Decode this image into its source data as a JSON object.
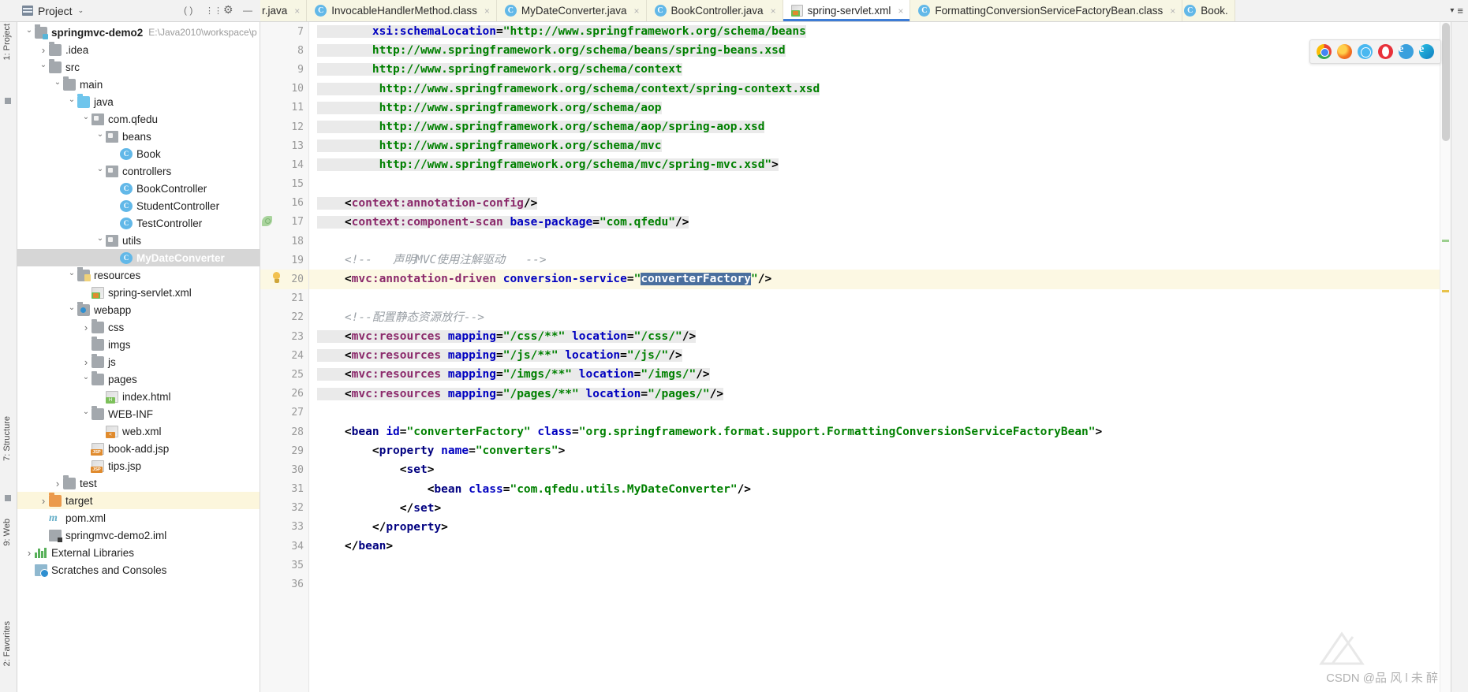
{
  "toolwindow": {
    "title": "Project",
    "dropdown_caret": "⌄",
    "buttons": [
      {
        "name": "collapse-all",
        "glyph": "( )"
      },
      {
        "name": "settings",
        "glyph": "⚙"
      },
      {
        "name": "hide",
        "glyph": "—"
      }
    ]
  },
  "tabs": [
    {
      "label": "r.java",
      "icon": "java-file-icon",
      "active": false,
      "truncated": true,
      "close": "×"
    },
    {
      "label": "InvocableHandlerMethod.class",
      "icon": "class-icon",
      "active": false,
      "close": "×"
    },
    {
      "label": "MyDateConverter.java",
      "icon": "class-icon",
      "active": false,
      "close": "×"
    },
    {
      "label": "BookController.java",
      "icon": "class-icon",
      "active": false,
      "close": "×"
    },
    {
      "label": "spring-servlet.xml",
      "icon": "xml-file-icon",
      "active": true,
      "close": "×"
    },
    {
      "label": "FormattingConversionServiceFactoryBean.class",
      "icon": "class-icon",
      "active": false,
      "close": "×"
    },
    {
      "label": "Book.",
      "icon": "class-icon",
      "active": false,
      "truncated": true,
      "close": ""
    }
  ],
  "tabs_end": {
    "dropdown": "▾",
    "list": "≡"
  },
  "left_strips": {
    "top_label": "1: Project",
    "bottom_labels": [
      "7: Structure",
      "9: Web",
      "2: Favorites"
    ]
  },
  "tree": [
    {
      "indent": 0,
      "arrow": "down",
      "icon": "module-icon",
      "label": "springmvc-demo2",
      "bold": true,
      "dim": "E:\\Java2010\\workspace\\p",
      "state": "normal"
    },
    {
      "indent": 1,
      "arrow": "right",
      "icon": "folder-grey",
      "label": ".idea",
      "state": "normal"
    },
    {
      "indent": 1,
      "arrow": "down",
      "icon": "folder-grey",
      "label": "src",
      "state": "normal"
    },
    {
      "indent": 2,
      "arrow": "down",
      "icon": "folder-grey",
      "label": "main",
      "state": "normal"
    },
    {
      "indent": 3,
      "arrow": "down",
      "icon": "folder-blue",
      "label": "java",
      "state": "normal"
    },
    {
      "indent": 4,
      "arrow": "down",
      "icon": "package-icon",
      "label": "com.qfedu",
      "state": "normal"
    },
    {
      "indent": 5,
      "arrow": "down",
      "icon": "package-icon",
      "label": "beans",
      "state": "normal"
    },
    {
      "indent": 6,
      "arrow": "none",
      "icon": "class-icon",
      "label": "Book",
      "state": "normal"
    },
    {
      "indent": 5,
      "arrow": "down",
      "icon": "package-icon",
      "label": "controllers",
      "state": "normal"
    },
    {
      "indent": 6,
      "arrow": "none",
      "icon": "class-icon",
      "label": "BookController",
      "state": "normal"
    },
    {
      "indent": 6,
      "arrow": "none",
      "icon": "class-icon",
      "label": "StudentController",
      "state": "normal"
    },
    {
      "indent": 6,
      "arrow": "none",
      "icon": "class-icon",
      "label": "TestController",
      "state": "normal"
    },
    {
      "indent": 5,
      "arrow": "down",
      "icon": "package-icon",
      "label": "utils",
      "state": "normal"
    },
    {
      "indent": 6,
      "arrow": "none",
      "icon": "class-icon",
      "label": "MyDateConverter",
      "state": "selected"
    },
    {
      "indent": 3,
      "arrow": "down",
      "icon": "folder-resources",
      "label": "resources",
      "state": "normal"
    },
    {
      "indent": 4,
      "arrow": "none",
      "icon": "xml-file-icon",
      "label": "spring-servlet.xml",
      "state": "normal"
    },
    {
      "indent": 3,
      "arrow": "down",
      "icon": "folder-web",
      "label": "webapp",
      "state": "normal"
    },
    {
      "indent": 4,
      "arrow": "right",
      "icon": "folder-grey",
      "label": "css",
      "state": "normal"
    },
    {
      "indent": 4,
      "arrow": "none",
      "icon": "folder-grey",
      "label": "imgs",
      "state": "normal"
    },
    {
      "indent": 4,
      "arrow": "right",
      "icon": "folder-grey",
      "label": "js",
      "state": "normal"
    },
    {
      "indent": 4,
      "arrow": "down",
      "icon": "folder-grey",
      "label": "pages",
      "state": "normal"
    },
    {
      "indent": 5,
      "arrow": "none",
      "icon": "html-file-icon",
      "label": "index.html",
      "state": "normal"
    },
    {
      "indent": 4,
      "arrow": "down",
      "icon": "folder-grey",
      "label": "WEB-INF",
      "state": "normal"
    },
    {
      "indent": 5,
      "arrow": "none",
      "icon": "webxml-file-icon",
      "label": "web.xml",
      "state": "normal"
    },
    {
      "indent": 4,
      "arrow": "none",
      "icon": "jsp-file-icon",
      "label": "book-add.jsp",
      "state": "normal"
    },
    {
      "indent": 4,
      "arrow": "none",
      "icon": "jsp-file-icon",
      "label": "tips.jsp",
      "state": "normal"
    },
    {
      "indent": 2,
      "arrow": "right",
      "icon": "folder-grey",
      "label": "test",
      "state": "normal"
    },
    {
      "indent": 1,
      "arrow": "right",
      "icon": "folder-orange",
      "label": "target",
      "state": "highlight"
    },
    {
      "indent": 1,
      "arrow": "none",
      "icon": "maven-icon",
      "label": "pom.xml",
      "state": "normal"
    },
    {
      "indent": 1,
      "arrow": "none",
      "icon": "iml-file-icon",
      "label": "springmvc-demo2.iml",
      "state": "normal"
    },
    {
      "indent": 0,
      "arrow": "right",
      "icon": "libraries-icon",
      "label": "External Libraries",
      "state": "normal"
    },
    {
      "indent": 0,
      "arrow": "none",
      "icon": "scratches-icon",
      "label": "Scratches and Consoles",
      "state": "normal"
    }
  ],
  "editor": {
    "first_line_number": 7,
    "current_line": 20,
    "selection_text": "converterFactory",
    "gutter_icons": [
      {
        "line": 17,
        "icon": "inspection-leaf-icon"
      },
      {
        "line": 20,
        "icon": "intention-bulb-icon"
      }
    ],
    "lines": [
      {
        "n": 7,
        "segs": [
          {
            "t": "        ",
            "c": "plain"
          },
          {
            "t": "xsi:schemaLocation",
            "c": "attr"
          },
          {
            "t": "=",
            "c": "punct"
          },
          {
            "t": "\"http://www.springframework.org/schema/beans",
            "c": "str"
          }
        ],
        "hl": true
      },
      {
        "n": 8,
        "segs": [
          {
            "t": "        http://www.springframework.org/schema/beans/spring-beans.xsd",
            "c": "str"
          }
        ],
        "hl": true
      },
      {
        "n": 9,
        "segs": [
          {
            "t": "        http://www.springframework.org/schema/context",
            "c": "str"
          }
        ],
        "hl": true
      },
      {
        "n": 10,
        "segs": [
          {
            "t": "         http://www.springframework.org/schema/context/spring-context.xsd",
            "c": "str"
          }
        ],
        "hl": true
      },
      {
        "n": 11,
        "segs": [
          {
            "t": "         http://www.springframework.org/schema/aop",
            "c": "str"
          }
        ],
        "hl": true
      },
      {
        "n": 12,
        "segs": [
          {
            "t": "         http://www.springframework.org/schema/aop/spring-aop.xsd",
            "c": "str"
          }
        ],
        "hl": true
      },
      {
        "n": 13,
        "segs": [
          {
            "t": "         http://www.springframework.org/schema/mvc",
            "c": "str"
          }
        ],
        "hl": true
      },
      {
        "n": 14,
        "segs": [
          {
            "t": "         http://www.springframework.org/schema/mvc/spring-mvc.xsd\"",
            "c": "str"
          },
          {
            "t": ">",
            "c": "punct"
          }
        ],
        "hl": true
      },
      {
        "n": 15,
        "segs": [],
        "hl": false
      },
      {
        "n": 16,
        "segs": [
          {
            "t": "    ",
            "c": "plain"
          },
          {
            "t": "<",
            "c": "punct"
          },
          {
            "t": "context:annotation-config",
            "c": "tagns"
          },
          {
            "t": "/>",
            "c": "punct"
          }
        ],
        "hl": true
      },
      {
        "n": 17,
        "segs": [
          {
            "t": "    ",
            "c": "plain"
          },
          {
            "t": "<",
            "c": "punct"
          },
          {
            "t": "context:component-scan",
            "c": "tagns"
          },
          {
            "t": " ",
            "c": "plain"
          },
          {
            "t": "base-package",
            "c": "attr"
          },
          {
            "t": "=",
            "c": "punct"
          },
          {
            "t": "\"com.qfedu\"",
            "c": "str"
          },
          {
            "t": "/>",
            "c": "punct"
          }
        ],
        "hl": true
      },
      {
        "n": 18,
        "segs": [],
        "hl": false
      },
      {
        "n": 19,
        "segs": [
          {
            "t": "    ",
            "c": "plain"
          },
          {
            "t": "<!--   声明MVC使用注解驱动   -->",
            "c": "cmt"
          }
        ],
        "hl": false
      },
      {
        "n": 20,
        "segs": [
          {
            "t": "    ",
            "c": "plain"
          },
          {
            "t": "<",
            "c": "punct"
          },
          {
            "t": "mvc:annotation-driven",
            "c": "tagns"
          },
          {
            "t": " ",
            "c": "plain"
          },
          {
            "t": "conversion-service",
            "c": "attr"
          },
          {
            "t": "=",
            "c": "punct"
          },
          {
            "t": "\"",
            "c": "str"
          },
          {
            "t": "converterFactory",
            "c": "selected"
          },
          {
            "t": "\"",
            "c": "str"
          },
          {
            "t": "/>",
            "c": "punct"
          }
        ],
        "hl": false,
        "current": true
      },
      {
        "n": 21,
        "segs": [],
        "hl": false
      },
      {
        "n": 22,
        "segs": [
          {
            "t": "    ",
            "c": "plain"
          },
          {
            "t": "<!--配置静态资源放行-->",
            "c": "cmt"
          }
        ],
        "hl": false
      },
      {
        "n": 23,
        "segs": [
          {
            "t": "    ",
            "c": "plain"
          },
          {
            "t": "<",
            "c": "punct"
          },
          {
            "t": "mvc:resources",
            "c": "tagns"
          },
          {
            "t": " ",
            "c": "plain"
          },
          {
            "t": "mapping",
            "c": "attr"
          },
          {
            "t": "=",
            "c": "punct"
          },
          {
            "t": "\"/css/**\"",
            "c": "str"
          },
          {
            "t": " ",
            "c": "plain"
          },
          {
            "t": "location",
            "c": "attr"
          },
          {
            "t": "=",
            "c": "punct"
          },
          {
            "t": "\"/css/\"",
            "c": "str"
          },
          {
            "t": "/>",
            "c": "punct"
          }
        ],
        "hl": true
      },
      {
        "n": 24,
        "segs": [
          {
            "t": "    ",
            "c": "plain"
          },
          {
            "t": "<",
            "c": "punct"
          },
          {
            "t": "mvc:resources",
            "c": "tagns"
          },
          {
            "t": " ",
            "c": "plain"
          },
          {
            "t": "mapping",
            "c": "attr"
          },
          {
            "t": "=",
            "c": "punct"
          },
          {
            "t": "\"/js/**\"",
            "c": "str"
          },
          {
            "t": " ",
            "c": "plain"
          },
          {
            "t": "location",
            "c": "attr"
          },
          {
            "t": "=",
            "c": "punct"
          },
          {
            "t": "\"/js/\"",
            "c": "str"
          },
          {
            "t": "/>",
            "c": "punct"
          }
        ],
        "hl": true
      },
      {
        "n": 25,
        "segs": [
          {
            "t": "    ",
            "c": "plain"
          },
          {
            "t": "<",
            "c": "punct"
          },
          {
            "t": "mvc:resources",
            "c": "tagns"
          },
          {
            "t": " ",
            "c": "plain"
          },
          {
            "t": "mapping",
            "c": "attr"
          },
          {
            "t": "=",
            "c": "punct"
          },
          {
            "t": "\"/imgs/**\"",
            "c": "str"
          },
          {
            "t": " ",
            "c": "plain"
          },
          {
            "t": "location",
            "c": "attr"
          },
          {
            "t": "=",
            "c": "punct"
          },
          {
            "t": "\"/imgs/\"",
            "c": "str"
          },
          {
            "t": "/>",
            "c": "punct"
          }
        ],
        "hl": true
      },
      {
        "n": 26,
        "segs": [
          {
            "t": "    ",
            "c": "plain"
          },
          {
            "t": "<",
            "c": "punct"
          },
          {
            "t": "mvc:resources",
            "c": "tagns"
          },
          {
            "t": " ",
            "c": "plain"
          },
          {
            "t": "mapping",
            "c": "attr"
          },
          {
            "t": "=",
            "c": "punct"
          },
          {
            "t": "\"/pages/**\"",
            "c": "str"
          },
          {
            "t": " ",
            "c": "plain"
          },
          {
            "t": "location",
            "c": "attr"
          },
          {
            "t": "=",
            "c": "punct"
          },
          {
            "t": "\"/pages/\"",
            "c": "str"
          },
          {
            "t": "/>",
            "c": "punct"
          }
        ],
        "hl": true
      },
      {
        "n": 27,
        "segs": [],
        "hl": false
      },
      {
        "n": 28,
        "segs": [
          {
            "t": "    ",
            "c": "plain"
          },
          {
            "t": "<",
            "c": "punct"
          },
          {
            "t": "bean",
            "c": "tag"
          },
          {
            "t": " ",
            "c": "plain"
          },
          {
            "t": "id",
            "c": "attr"
          },
          {
            "t": "=",
            "c": "punct"
          },
          {
            "t": "\"converterFactory\"",
            "c": "str"
          },
          {
            "t": " ",
            "c": "plain"
          },
          {
            "t": "class",
            "c": "attr"
          },
          {
            "t": "=",
            "c": "punct"
          },
          {
            "t": "\"org.springframework.format.support.FormattingConversionServiceFactoryBean\"",
            "c": "str"
          },
          {
            "t": ">",
            "c": "punct"
          }
        ],
        "hl": false
      },
      {
        "n": 29,
        "segs": [
          {
            "t": "        ",
            "c": "plain"
          },
          {
            "t": "<",
            "c": "punct"
          },
          {
            "t": "property",
            "c": "tag"
          },
          {
            "t": " ",
            "c": "plain"
          },
          {
            "t": "name",
            "c": "attr"
          },
          {
            "t": "=",
            "c": "punct"
          },
          {
            "t": "\"converters\"",
            "c": "str"
          },
          {
            "t": ">",
            "c": "punct"
          }
        ],
        "hl": false
      },
      {
        "n": 30,
        "segs": [
          {
            "t": "            ",
            "c": "plain"
          },
          {
            "t": "<",
            "c": "punct"
          },
          {
            "t": "set",
            "c": "tag"
          },
          {
            "t": ">",
            "c": "punct"
          }
        ],
        "hl": false
      },
      {
        "n": 31,
        "segs": [
          {
            "t": "                ",
            "c": "plain"
          },
          {
            "t": "<",
            "c": "punct"
          },
          {
            "t": "bean",
            "c": "tag"
          },
          {
            "t": " ",
            "c": "plain"
          },
          {
            "t": "class",
            "c": "attr"
          },
          {
            "t": "=",
            "c": "punct"
          },
          {
            "t": "\"com.qfedu.utils.MyDateConverter\"",
            "c": "str"
          },
          {
            "t": "/>",
            "c": "punct"
          }
        ],
        "hl": false
      },
      {
        "n": 32,
        "segs": [
          {
            "t": "            ",
            "c": "plain"
          },
          {
            "t": "</",
            "c": "punct"
          },
          {
            "t": "set",
            "c": "tag"
          },
          {
            "t": ">",
            "c": "punct"
          }
        ],
        "hl": false
      },
      {
        "n": 33,
        "segs": [
          {
            "t": "        ",
            "c": "plain"
          },
          {
            "t": "</",
            "c": "punct"
          },
          {
            "t": "property",
            "c": "tag"
          },
          {
            "t": ">",
            "c": "punct"
          }
        ],
        "hl": false
      },
      {
        "n": 34,
        "segs": [
          {
            "t": "    ",
            "c": "plain"
          },
          {
            "t": "</",
            "c": "punct"
          },
          {
            "t": "bean",
            "c": "tag"
          },
          {
            "t": ">",
            "c": "punct"
          }
        ],
        "hl": false
      },
      {
        "n": 35,
        "segs": [],
        "hl": false
      },
      {
        "n": 36,
        "segs": [],
        "hl": false
      }
    ]
  },
  "browsers": [
    {
      "name": "chrome-browser-icon",
      "label": ""
    },
    {
      "name": "firefox-browser-icon",
      "label": ""
    },
    {
      "name": "safari-browser-icon",
      "label": ""
    },
    {
      "name": "opera-browser-icon",
      "label": ""
    },
    {
      "name": "ie-browser-icon",
      "label": "e"
    },
    {
      "name": "edge-browser-icon",
      "label": "e"
    }
  ],
  "watermark": "CSDN @品 风 l 未 醉",
  "colors": {
    "accent": "#3c7cd6",
    "selection": "#4a6f9e",
    "current_line": "#fcf8e3",
    "string": "#008000",
    "attribute": "#0000c0",
    "tag_ns": "#8b2a6b",
    "comment": "#9aa0a6"
  }
}
